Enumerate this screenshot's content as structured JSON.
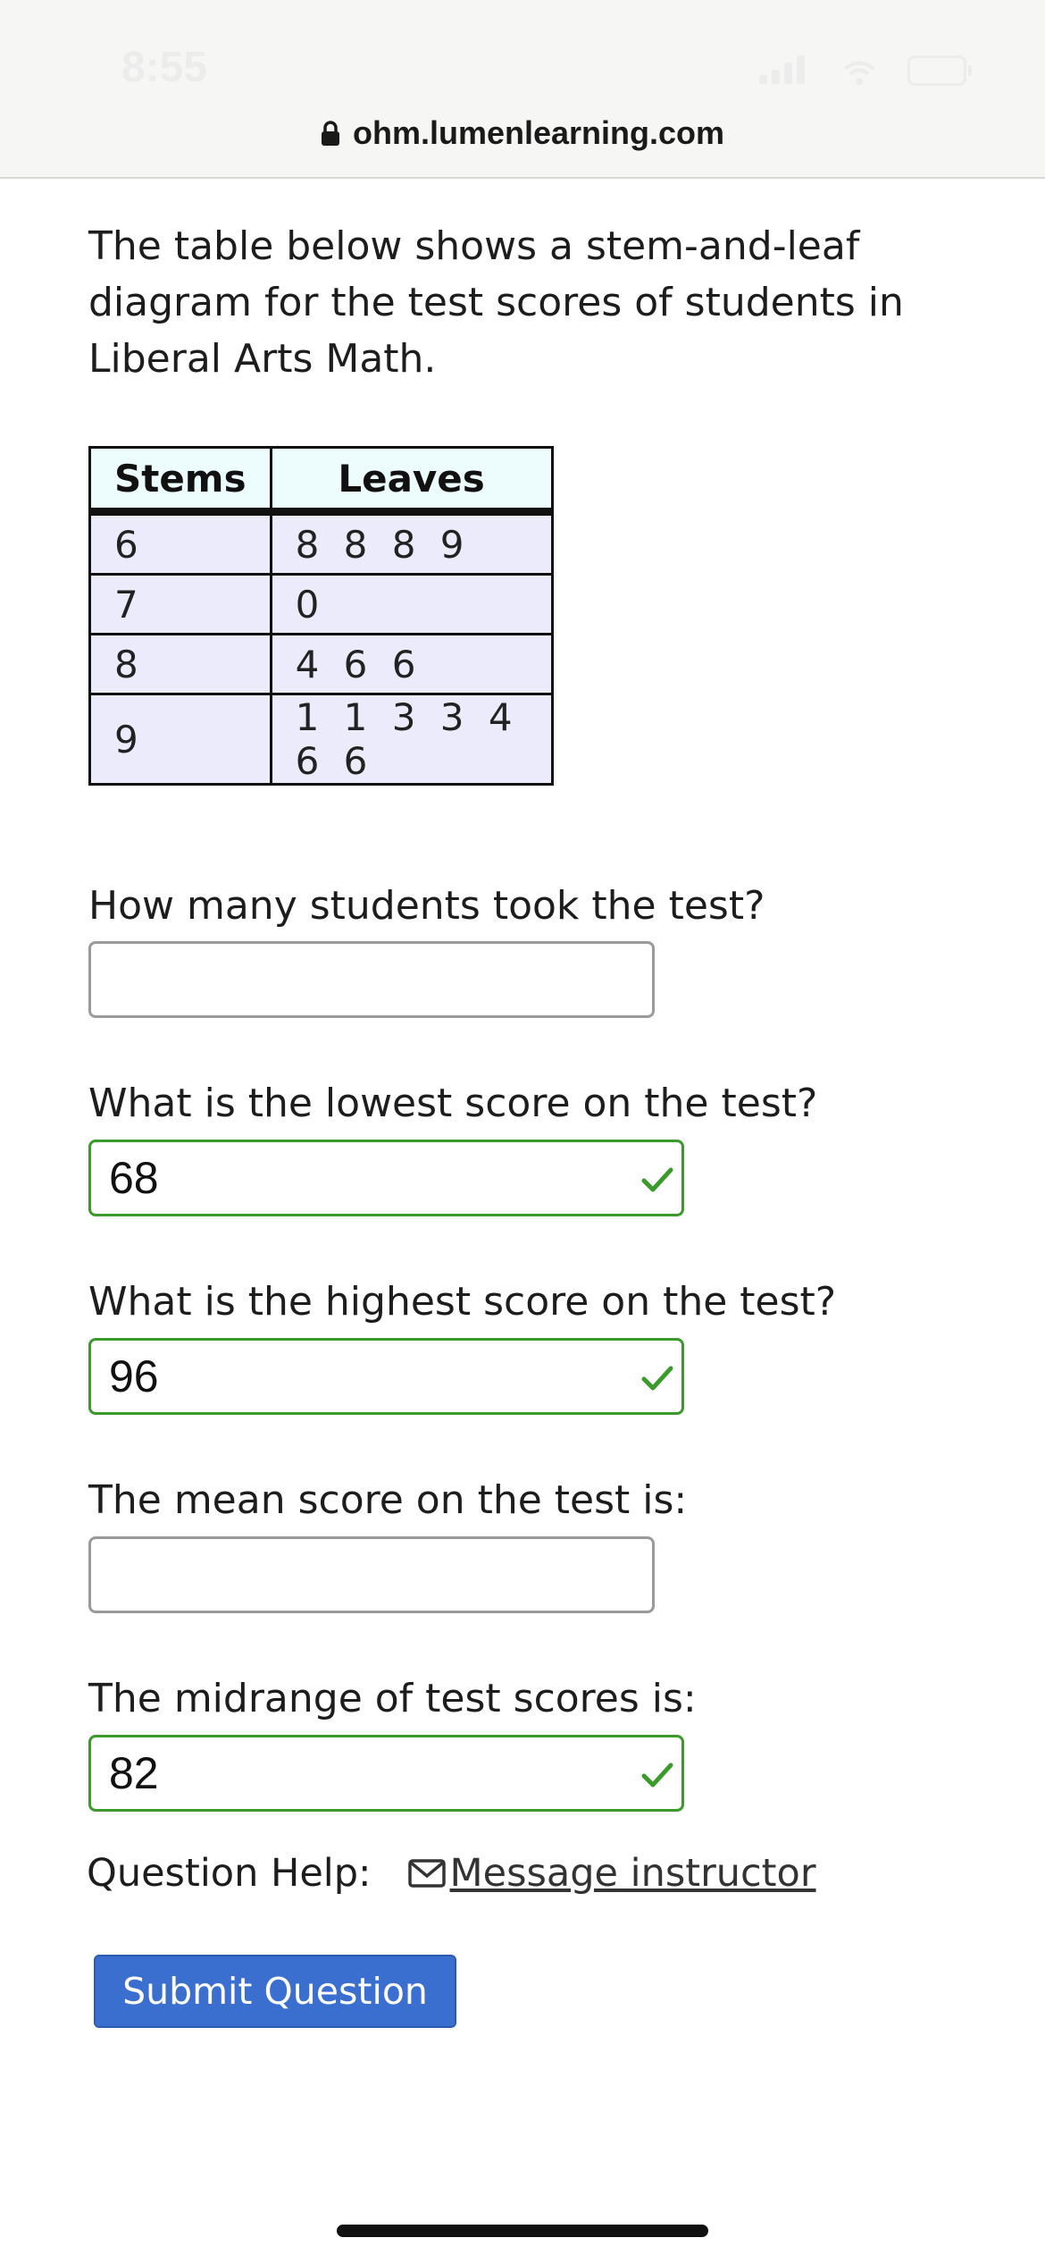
{
  "status_bar": {
    "time": "8:55"
  },
  "browser": {
    "url": "ohm.lumenlearning.com"
  },
  "intro": "The table below shows a stem-and-leaf diagram for the test scores of students in Liberal Arts Math.",
  "table": {
    "headers": [
      "Stems",
      "Leaves"
    ],
    "rows": [
      {
        "stem": "6",
        "leaves": "8 8 8 9"
      },
      {
        "stem": "7",
        "leaves": "0"
      },
      {
        "stem": "8",
        "leaves": "4 6 6"
      },
      {
        "stem": "9",
        "leaves": "1 1 3 3 4 6 6"
      }
    ]
  },
  "questions": [
    {
      "prompt": "How many students took the test?",
      "value": "",
      "status": "empty"
    },
    {
      "prompt": "What is the lowest score on the test?",
      "value": "68",
      "status": "correct"
    },
    {
      "prompt": "What is the highest score on the test?",
      "value": "96",
      "status": "correct"
    },
    {
      "prompt": "The mean score on the test is:",
      "value": "",
      "status": "empty"
    },
    {
      "prompt": "The midrange of test scores is:",
      "value": "82",
      "status": "correct"
    }
  ],
  "help": {
    "label": "Question Help:",
    "link": "Message instructor"
  },
  "submit_label": "Submit Question",
  "colors": {
    "correct": "#3a9a2a",
    "button": "#3a6fd0",
    "table_header": "#edfdfd",
    "table_cell": "#ebebfb"
  }
}
